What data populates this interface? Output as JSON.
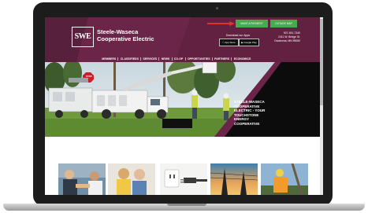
{
  "site": {
    "logo_text": "SWE",
    "name_line1": "Steele-Waseca",
    "name_line2": "Cooperative Electric"
  },
  "header": {
    "make_payment_label": "MAKE A PAYMENT",
    "outage_map_label": "OUTAGE MAP",
    "download_label": "Download our Apps",
    "app_store_label": "App Store",
    "google_play_label": "Google Play",
    "phone": "507-451-7340",
    "address_line1": "2411 W. Bridge St.",
    "address_line2": "Owatonna, MN 55060"
  },
  "nav": {
    "items": [
      "MEMBERS",
      "CLASSIFIEDS",
      "SERVICES",
      "NEWS",
      "CO-OP",
      "OPPORTUNITIES",
      "PARTNERS",
      "ECONOMICS"
    ]
  },
  "hero": {
    "stop_sign": "STOP",
    "caption": [
      "STEELE-WASECA",
      "COOPERATIVE",
      "ELECTRIC - YOUR",
      "TOUCHSTONE",
      "ENERGY",
      "COOPERATIVE"
    ]
  },
  "thumbnails": [
    {
      "icon": "handshake-photo"
    },
    {
      "icon": "family-photo"
    },
    {
      "icon": "outlet-plug-photo"
    },
    {
      "icon": "power-lines-sunset-photo"
    },
    {
      "icon": "lineworker-photo"
    }
  ],
  "colors": {
    "brand_maroon": "#6b2548",
    "button_green": "#49a94d",
    "arrow_red": "#e0322d"
  }
}
